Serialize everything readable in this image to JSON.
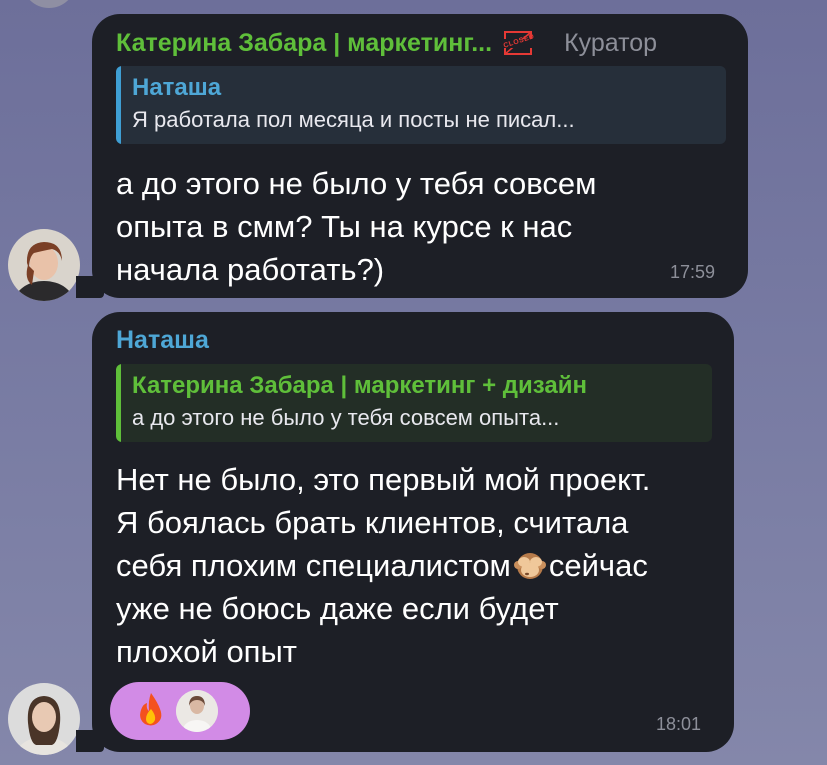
{
  "messages": [
    {
      "sender": "Катерина Забара | маркетинг...",
      "badge": "CLOSED",
      "role": "Куратор",
      "reply_to": {
        "author": "Наташа",
        "text": "Я работала пол месяца и посты не писал..."
      },
      "lines": [
        "а до этого не было у тебя совсем",
        "опыта в смм? Ты на курсе к нас",
        "начала работать?)"
      ],
      "time": "17:59"
    },
    {
      "sender": "Наташа",
      "reply_to": {
        "author": "Катерина Забара | маркетинг + дизайн",
        "text": "а до этого не было у тебя совсем опыта..."
      },
      "lines": [
        "Нет не было, это первый мой проект.",
        "Я боялась брать клиентов, считала",
        "себя плохим специалистом",
        "сейчас",
        "уже не боюсь даже если будет",
        "плохой опыт"
      ],
      "inline_emoji": "see-no-evil-monkey-icon",
      "reactions": {
        "emoji": "fire-icon"
      },
      "time": "18:01"
    }
  ],
  "colors": {
    "background": "#777aa2",
    "bubble": "#1d1f26",
    "green_name": "#5fbf3a",
    "blue_name": "#4ea7d6",
    "reaction_pill": "#d28be6"
  }
}
